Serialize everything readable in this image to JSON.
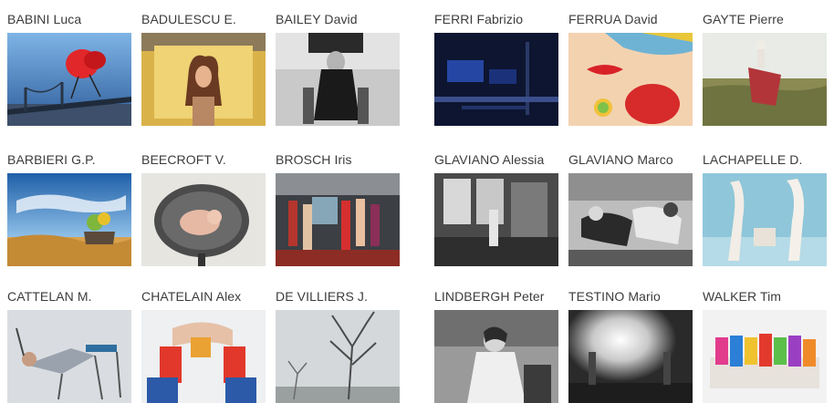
{
  "gallery": {
    "left": [
      {
        "name": "BABINI Luca",
        "image": "red-chair-over-bridge-photo"
      },
      {
        "name": "BADULESCU E.",
        "image": "woman-yellow-backdrop-photo"
      },
      {
        "name": "BAILEY David",
        "image": "bw-figure-chair-photo"
      },
      {
        "name": "BARBIERI G.P.",
        "image": "desert-sky-still-life-photo"
      },
      {
        "name": "BEECROFT V.",
        "image": "baby-in-chair-photo"
      },
      {
        "name": "BROSCH Iris",
        "image": "figures-in-colorful-room-photo"
      },
      {
        "name": "CATTELAN M.",
        "image": "reclining-figure-chair-photo"
      },
      {
        "name": "CHATELAIN Alex",
        "image": "colored-cylinders-figure-photo"
      },
      {
        "name": "DE VILLIERS J.",
        "image": "bare-tree-grey-sky-photo"
      }
    ],
    "right": [
      {
        "name": "FERRI Fabrizio",
        "image": "dark-blue-interior-photo"
      },
      {
        "name": "FERRUA David",
        "image": "red-lips-popart-photo"
      },
      {
        "name": "GAYTE Pierre",
        "image": "field-figure-flag-photo"
      },
      {
        "name": "GLAVIANO Alessia",
        "image": "bw-loft-interior-photo"
      },
      {
        "name": "GLAVIANO Marco",
        "image": "bw-models-lounging-photo"
      },
      {
        "name": "LACHAPELLE D.",
        "image": "mannequins-blue-room-photo"
      },
      {
        "name": "LINDBERGH Peter",
        "image": "bw-woman-portrait-photo"
      },
      {
        "name": "TESTINO Mario",
        "image": "bw-bright-window-photo"
      },
      {
        "name": "WALKER Tim",
        "image": "group-on-sofa-photo"
      }
    ]
  }
}
